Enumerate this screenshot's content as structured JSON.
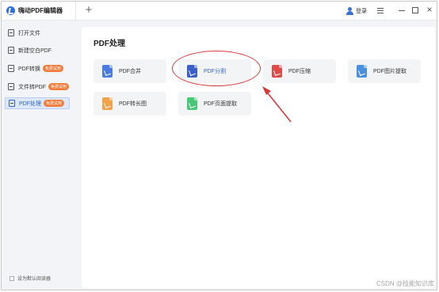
{
  "app": {
    "title": "嗨动PDF编辑器",
    "new_tab": "+"
  },
  "titlebar": {
    "login_label": "登录",
    "close_glyph": "×"
  },
  "sidebar": {
    "items": [
      {
        "label": "打开文件",
        "icon": "open-file-icon",
        "badge": ""
      },
      {
        "label": "新建空白PDF",
        "icon": "new-pdf-icon",
        "badge": ""
      },
      {
        "label": "PDF转换",
        "icon": "pdf-convert-icon",
        "badge": "免费试用"
      },
      {
        "label": "文件转PDF",
        "icon": "file-to-pdf-icon",
        "badge": "免费试用"
      },
      {
        "label": "PDF处理",
        "icon": "pdf-process-icon",
        "badge": "免费试用",
        "active": true
      }
    ],
    "default_reader_label": "设为默认阅读器"
  },
  "main": {
    "title": "PDF处理",
    "tools": [
      {
        "label": "PDF合并",
        "color": "#4a7be0"
      },
      {
        "label": "PDF分割",
        "color": "#3a5fc8",
        "highlighted": true
      },
      {
        "label": "PDF压缩",
        "color": "#e24a4a"
      },
      {
        "label": "PDF图片提取",
        "color": "#4a8fe0"
      },
      {
        "label": "PDF转长图",
        "color": "#f2a24a"
      },
      {
        "label": "PDF页面提取",
        "color": "#4ac87a"
      }
    ]
  },
  "annotation": {
    "ring_color": "#d9383a"
  },
  "watermark": "CSDN @技能知识库"
}
